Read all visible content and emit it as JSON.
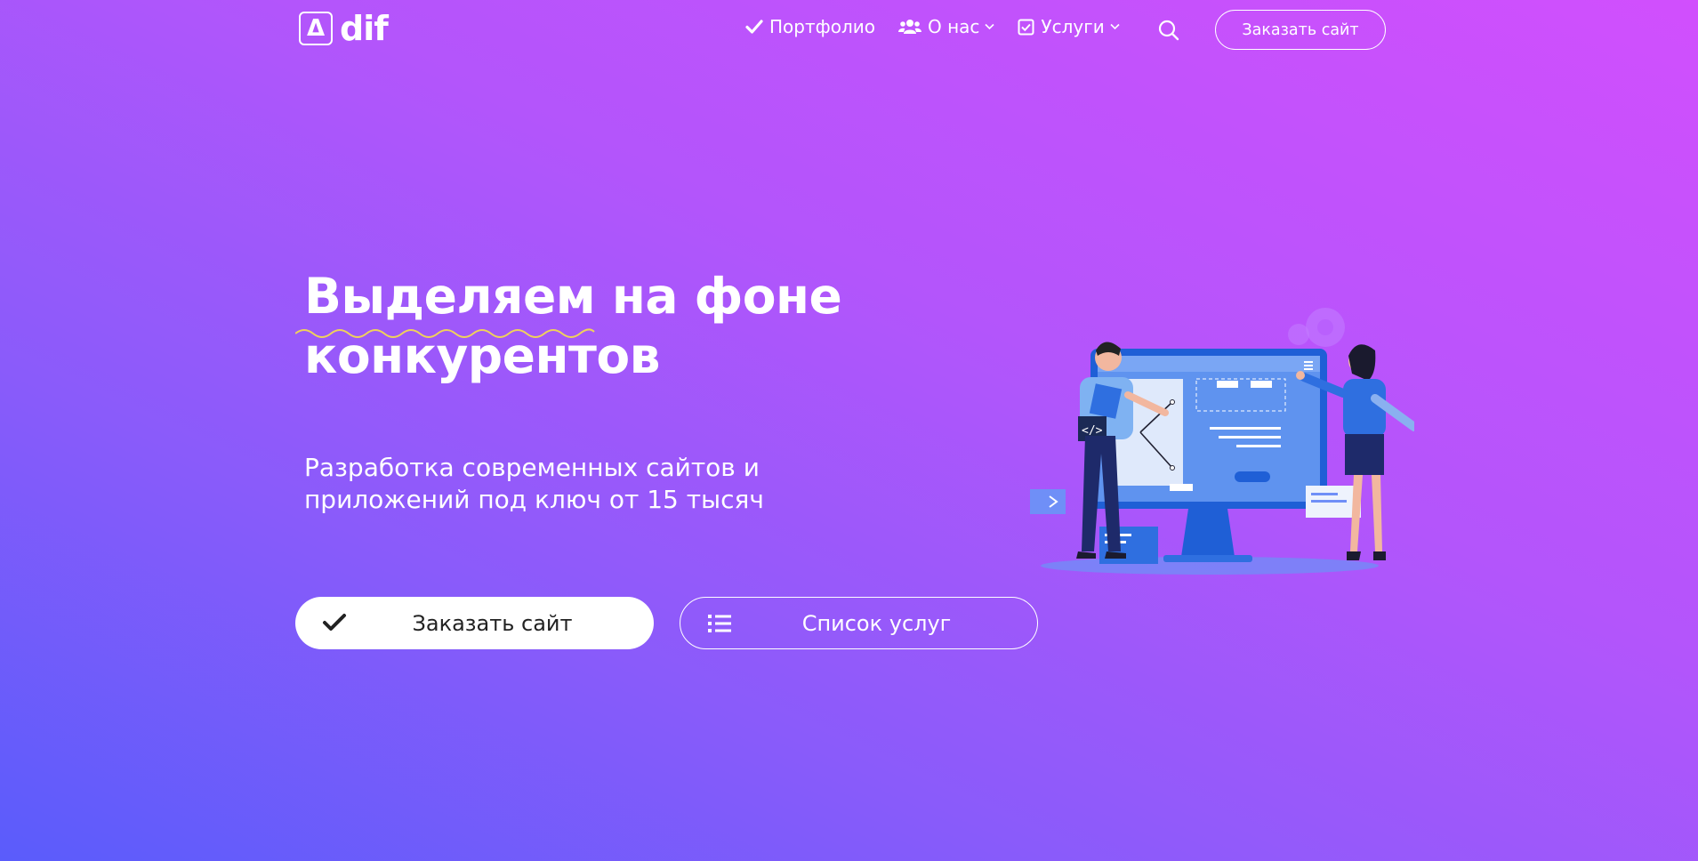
{
  "header": {
    "logo_mark": "Δ",
    "logo_text": "dif",
    "nav": [
      {
        "label": "Портфолио",
        "icon": "check-icon"
      },
      {
        "label": "О нас",
        "icon": "users-icon",
        "has_dropdown": true
      },
      {
        "label": "Услуги",
        "icon": "checkbox-icon",
        "has_dropdown": true
      }
    ],
    "search_icon": "search-icon",
    "cta_label": "Заказать сайт"
  },
  "hero": {
    "title_line1": "Выделяем на фоне",
    "title_line2": "конкурентов",
    "subtitle_line1": "Разработка современных сайтов и",
    "subtitle_line2": "приложений под ключ от 15 тысяч",
    "primary_button": {
      "label": "Заказать сайт",
      "icon": "check-icon"
    },
    "secondary_button": {
      "label": "Список услуг",
      "icon": "list-icon"
    }
  },
  "colors": {
    "gradient_top": "#d14ffd",
    "gradient_bottom": "#5a5cfb",
    "squiggle": "#f0d25a",
    "illustration_blue": "#2f6fe0"
  }
}
